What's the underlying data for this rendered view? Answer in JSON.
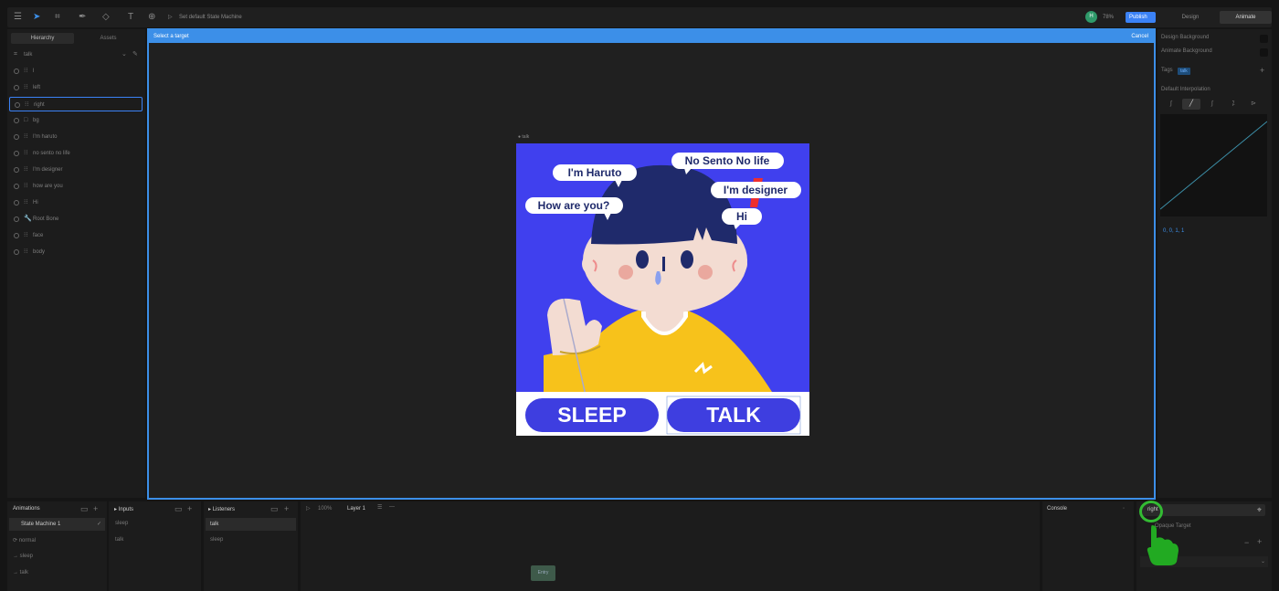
{
  "toolbar": {
    "state_machine_label": "Set default State Machine",
    "avatar_initial": "H",
    "zoom": "78%",
    "publish_label": "Publish",
    "modes": [
      "Design",
      "Animate"
    ]
  },
  "left_panel": {
    "tabs": [
      "Hierarchy",
      "Assets"
    ],
    "root": "talk",
    "items": [
      "l",
      "left",
      "right",
      "bg",
      "I'm haruto",
      "no sento no life",
      "I'm designer",
      "how are you",
      "Hi",
      "Root Bone",
      "face",
      "body"
    ]
  },
  "canvas": {
    "target_prompt": "Select a target",
    "cancel_label": "Cancel",
    "artboard_name": "talk",
    "bubbles": [
      "I'm Haruto",
      "No Sento No life",
      "I'm designer",
      "How are you?",
      "Hi"
    ],
    "buttons": [
      "SLEEP",
      "TALK"
    ],
    "colors": {
      "background": "#4040ee",
      "hair": "#1f2a6b",
      "shirt": "#f7c21b",
      "skin": "#f3dcd2",
      "exclaim": "#ee2f2f"
    }
  },
  "right_panel": {
    "design_background": "Design Background",
    "animate_background": "Animate Background",
    "tags_label": "Tags",
    "tag_chip": "talk",
    "interp_label": "Default Interpolation",
    "curve_values": "0, 0, 1, 1"
  },
  "bottom": {
    "animations_title": "Animations",
    "animations": [
      "State Machine 1",
      "normal",
      "sleep",
      "talk"
    ],
    "inputs_title": "Inputs",
    "inputs": [
      "sleep",
      "talk"
    ],
    "listeners_title": "Listeners",
    "listeners": [
      "talk",
      "sleep"
    ],
    "timeline_zoom": "100%",
    "layer_label": "Layer 1",
    "entry_label": "Entry",
    "console_title": "Console",
    "target_value": "right",
    "opaque_target": "Opaque Target",
    "trigger_value": "talk"
  }
}
